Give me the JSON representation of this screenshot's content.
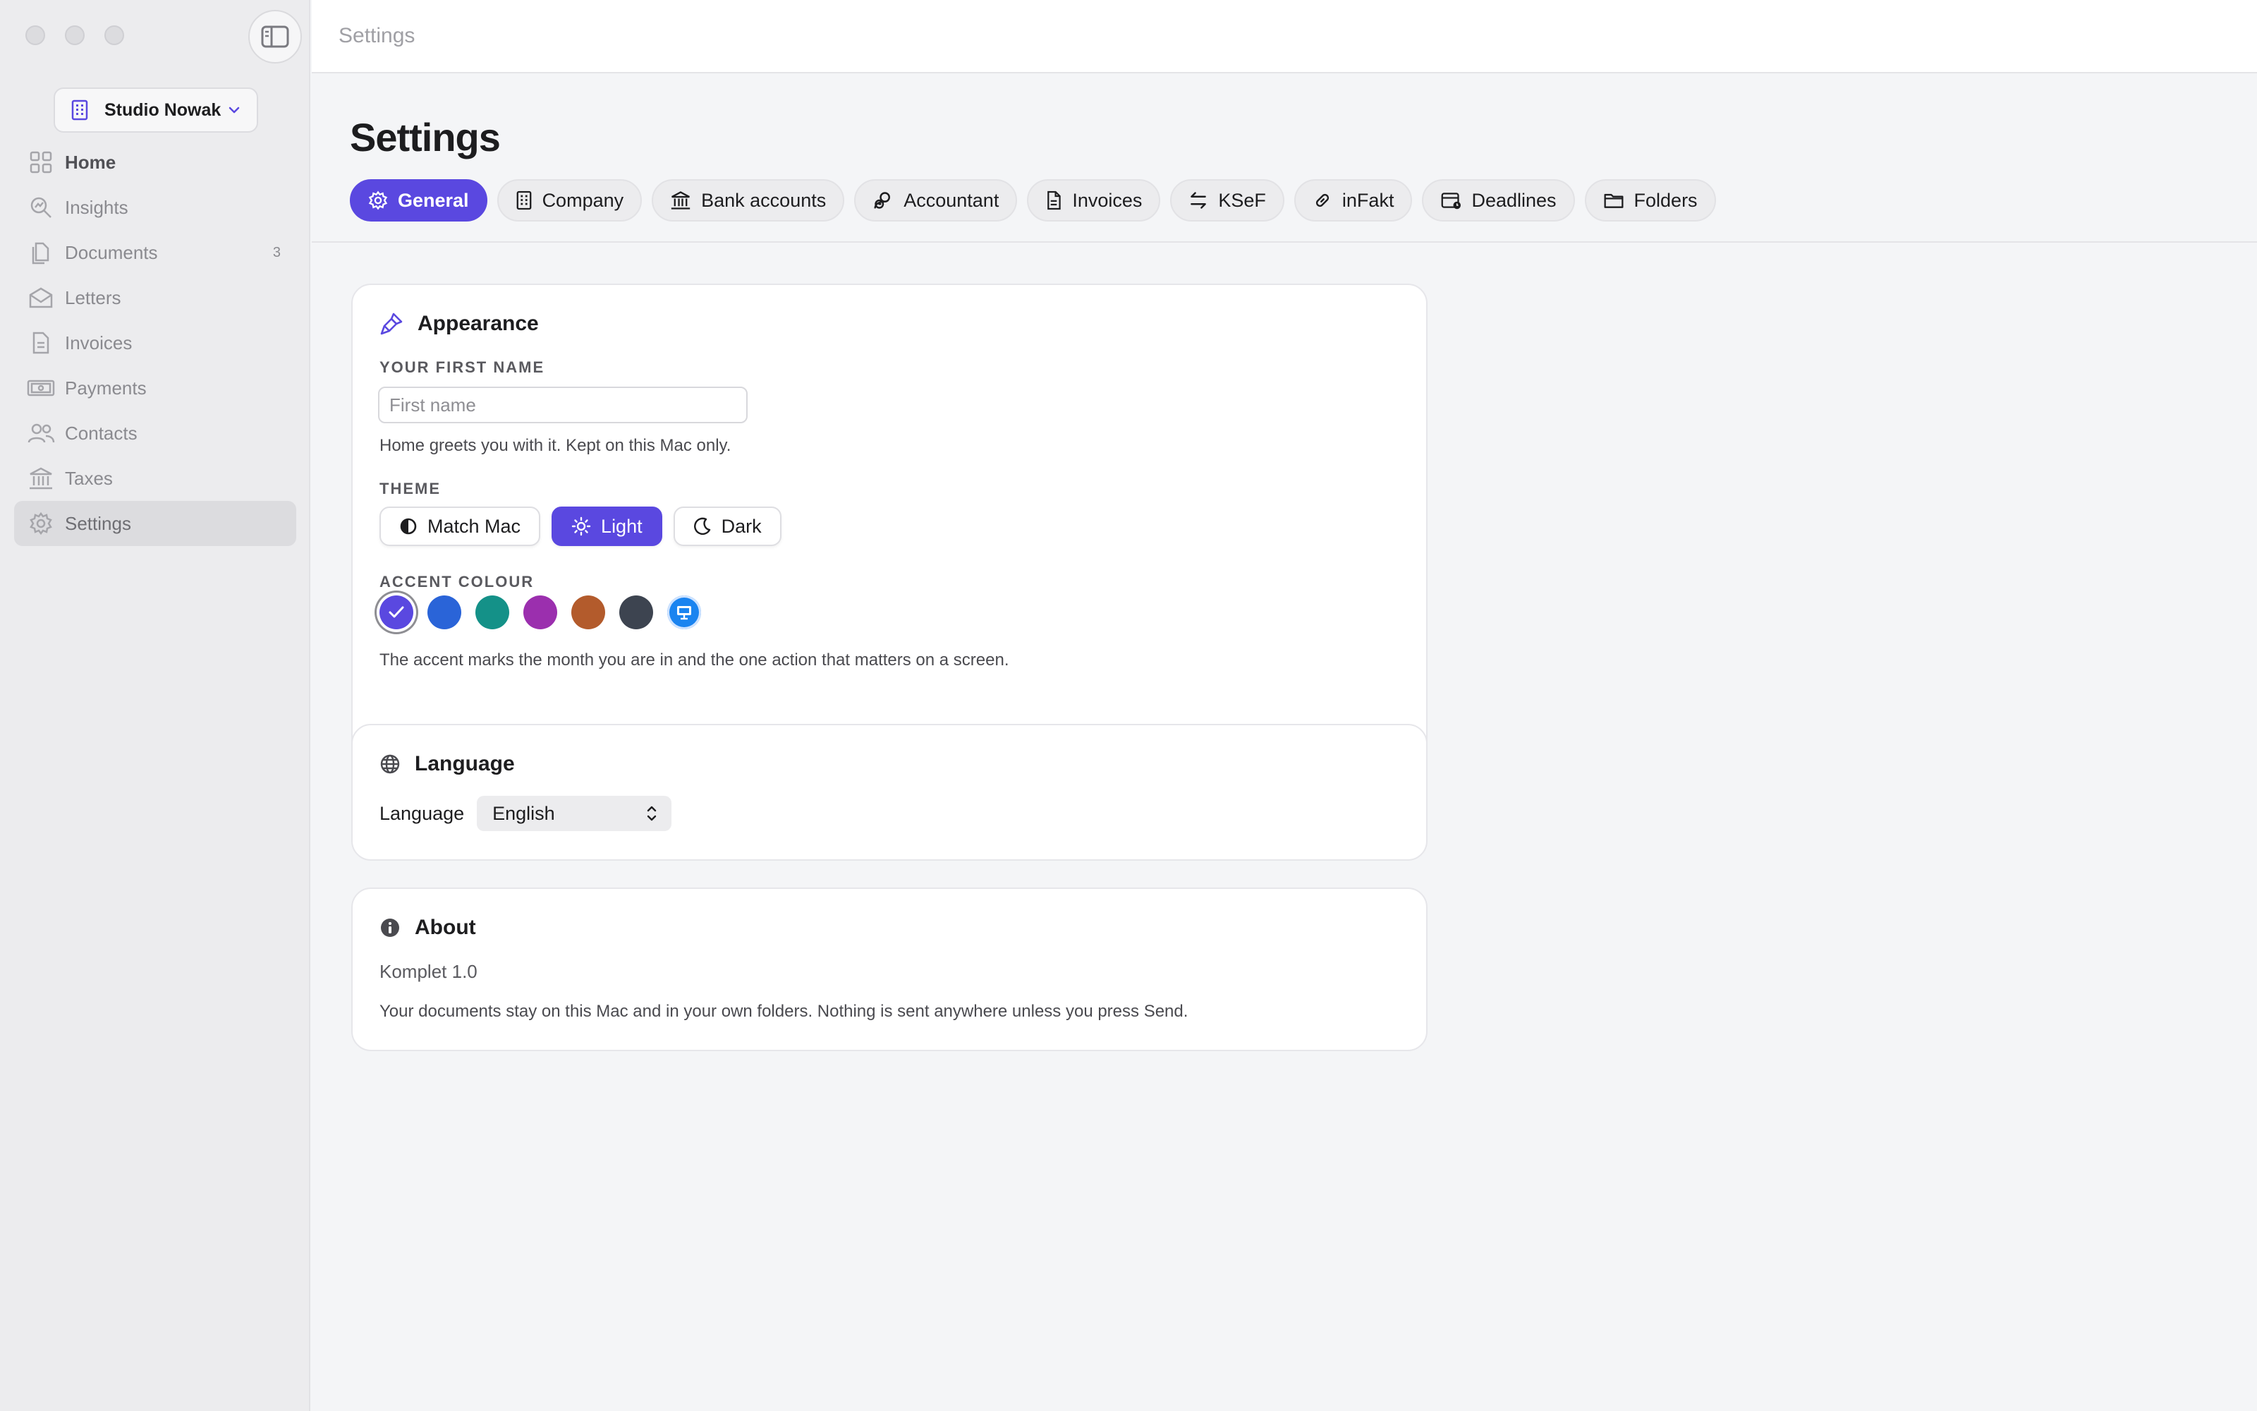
{
  "window": {
    "title": "Settings"
  },
  "sidebar": {
    "workspace": "Studio Nowak",
    "items": [
      {
        "label": "Home",
        "icon": "grid-icon"
      },
      {
        "label": "Insights",
        "icon": "magnifier-chart-icon"
      },
      {
        "label": "Documents",
        "icon": "documents-icon",
        "count": "3"
      },
      {
        "label": "Letters",
        "icon": "envelope-icon"
      },
      {
        "label": "Invoices",
        "icon": "invoice-icon"
      },
      {
        "label": "Payments",
        "icon": "banknote-icon"
      },
      {
        "label": "Contacts",
        "icon": "people-icon"
      },
      {
        "label": "Taxes",
        "icon": "bank-icon"
      },
      {
        "label": "Settings",
        "icon": "gear-icon",
        "active": true
      }
    ]
  },
  "page": {
    "title": "Settings",
    "tabs": [
      {
        "label": "General",
        "icon": "gear-icon",
        "active": true
      },
      {
        "label": "Company",
        "icon": "building-icon"
      },
      {
        "label": "Bank accounts",
        "icon": "bank-icon"
      },
      {
        "label": "Accountant",
        "icon": "accountant-icon"
      },
      {
        "label": "Invoices",
        "icon": "document-icon"
      },
      {
        "label": "KSeF",
        "icon": "arrows-swap-icon"
      },
      {
        "label": "inFakt",
        "icon": "link-icon"
      },
      {
        "label": "Deadlines",
        "icon": "calendar-icon"
      },
      {
        "label": "Folders",
        "icon": "folder-icon"
      }
    ]
  },
  "appearance": {
    "title": "Appearance",
    "first_name_label": "YOUR FIRST NAME",
    "first_name_placeholder": "First name",
    "first_name_value": "",
    "first_name_hint": "Home greets you with it. Kept on this Mac only.",
    "theme_label": "THEME",
    "theme_options": [
      "Match Mac",
      "Light",
      "Dark"
    ],
    "theme_selected": "Light",
    "accent_label": "ACCENT COLOUR",
    "accent_colors": [
      "#5a48e0",
      "#2a64d8",
      "#149188",
      "#9b2fae",
      "#b35b2c",
      "#3d4450",
      "#1a84f0"
    ],
    "accent_selected_index": 0,
    "accent_hint": "The accent marks the month you are in and the one action that matters on a screen."
  },
  "language": {
    "title": "Language",
    "label": "Language",
    "selected": "English"
  },
  "about": {
    "title": "About",
    "version": "Komplet 1.0",
    "text": "Your documents stay on this Mac and in your own folders. Nothing is sent anywhere unless you press Send."
  },
  "colors": {
    "accent": "#5a48e0",
    "sidebar_bg": "#ececee",
    "page_bg": "#f4f5f7"
  }
}
